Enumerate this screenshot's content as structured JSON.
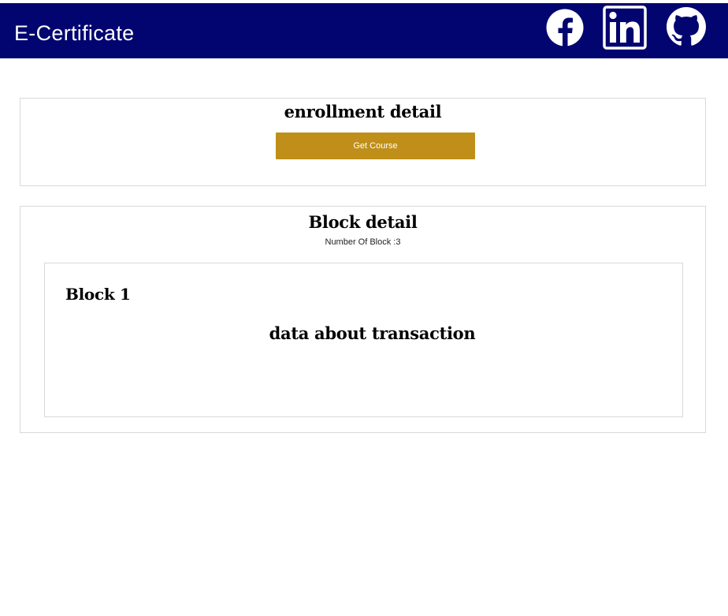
{
  "header": {
    "brand": "E-Certificate",
    "social_icons": [
      "facebook-icon",
      "linkedin-icon",
      "github-icon"
    ],
    "background_color": "#020570"
  },
  "enrollment": {
    "title": "enrollment detail",
    "button_label": "Get Course",
    "button_color": "#bf8f19"
  },
  "blocks": {
    "title": "Block detail",
    "count_label": "Number Of Block :3",
    "items": [
      {
        "name": "Block 1",
        "content": "data about transaction"
      }
    ]
  }
}
